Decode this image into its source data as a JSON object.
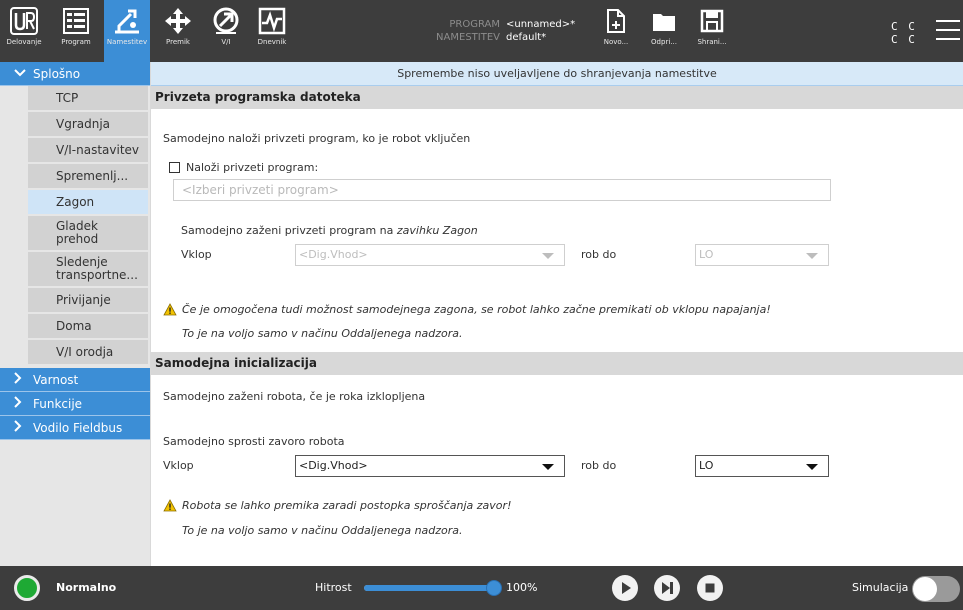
{
  "header": {
    "tabs": [
      {
        "label": "Delovanje",
        "icon": "ur-logo-icon"
      },
      {
        "label": "Program",
        "icon": "program-list-icon"
      },
      {
        "label": "Namestitev",
        "icon": "installation-icon",
        "active": true
      }
    ],
    "tools": [
      {
        "label": "Premik",
        "icon": "move-arrows-icon"
      },
      {
        "label": "V/I",
        "icon": "io-icon"
      },
      {
        "label": "Dnevnik",
        "icon": "log-icon"
      }
    ],
    "program_key": "PROGRAM",
    "program_value": "<unnamed>*",
    "installation_key": "NAMESTITEV",
    "installation_value": "default*",
    "file_actions": [
      {
        "label": "Novo...",
        "icon": "new-file-icon"
      },
      {
        "label": "Odpri...",
        "icon": "open-folder-icon"
      },
      {
        "label": "Shrani...",
        "icon": "save-icon"
      }
    ],
    "cc_top": "C C",
    "cc_bottom": "C C"
  },
  "sidebar": {
    "groups": [
      {
        "label": "Splošno",
        "expanded": true
      },
      {
        "label": "Varnost"
      },
      {
        "label": "Funkcije"
      },
      {
        "label": "Vodilo Fieldbus"
      }
    ],
    "items": [
      "TCP",
      "Vgradnja",
      "V/I-nastavitev",
      "Spremenlj...",
      "Zagon",
      "Gladek prehod",
      "Sledenje transportne...",
      "Privijanje",
      "Doma",
      "V/I orodja"
    ],
    "selected": "Zagon"
  },
  "main": {
    "notice": "Spremembe niso uveljavljene do shranjevanja namestitve",
    "section1": {
      "title": "Privzeta programska datoteka",
      "description": "Samodejno naloži privzeti program, ko je robot vključen",
      "checkbox_label": "Naloži privzeti program:",
      "program_placeholder": "<Izberi privzeti program>",
      "autostart_prefix": "Samodejno zaženi privzeti program na ",
      "autostart_tab": "zavihku Zagon",
      "input_label": "Vklop",
      "input_value": "<Dig.Vhod>",
      "edge_label": "rob do",
      "edge_value": "LO",
      "warning": "Če je omogočena tudi možnost samodejnega zagona, se robot lahko začne premikati ob vklopu napajanja!",
      "note": "To je na voljo samo v načinu Oddaljenega nadzora."
    },
    "section2": {
      "title": "Samodejna inicializacija",
      "description": "Samodejno zaženi robota, če je roka izklopljena",
      "brake_label": "Samodejno sprosti zavoro robota",
      "input_label": "Vklop",
      "input_value": "<Dig.Vhod>",
      "edge_label": "rob do",
      "edge_value": "LO",
      "warning": "Robota se lahko premika zaradi postopka sproščanja zavor!",
      "note": "To je na voljo samo v načinu Oddaljenega nadzora."
    }
  },
  "footer": {
    "status": "Normalno",
    "status_color": "#1ea934",
    "speed_label": "Hitrost",
    "speed_value": "100%",
    "speed_fraction": 1.0,
    "simulation_label": "Simulacija",
    "accent": "#3c8ed6"
  }
}
